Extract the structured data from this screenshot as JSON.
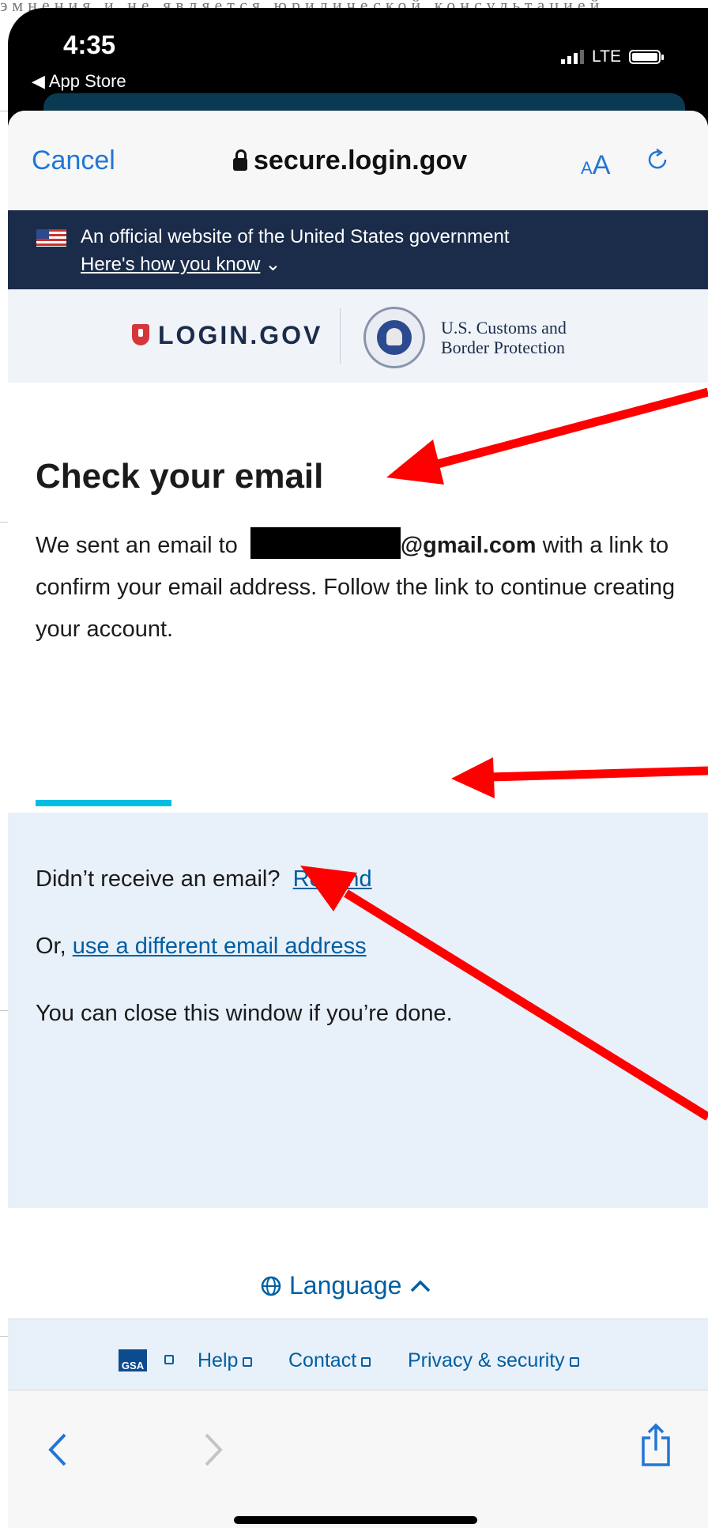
{
  "background_text": "эмнения и не является юридической консультацией",
  "status_bar": {
    "time": "4:35",
    "back_app": "◀ App Store",
    "network": "LTE"
  },
  "browser": {
    "cancel_label": "Cancel",
    "url": "secure.login.gov",
    "text_size_small": "A",
    "text_size_large": "A"
  },
  "gov_banner": {
    "text": "An official website of the United States government",
    "link": "Here's how you know"
  },
  "logos": {
    "logingov": "LOGIN.GOV",
    "agency_line1": "U.S. Customs and",
    "agency_line2": "Border Protection"
  },
  "main": {
    "title": "Check your email",
    "sent_prefix": "We sent an email to",
    "email_domain": "@gmail.com",
    "sent_suffix": " with a link to confirm your email address. Follow the link to continue creating your account.",
    "resend_prompt": "Didn’t receive an email?",
    "resend_link": "Resend",
    "or_prefix": "Or,",
    "different_email_link": "use a different email address",
    "close_text": "You can close this window if you’re done."
  },
  "footer": {
    "language": "Language",
    "gsa": "GSA",
    "help": "Help",
    "contact": "Contact",
    "privacy": "Privacy & security"
  },
  "colors": {
    "link": "#005ea2",
    "gov_banner": "#1b2c4a",
    "accent_rule": "#00bde3",
    "annotation_arrow": "#ff0000",
    "browser_blue": "#2176d6"
  }
}
